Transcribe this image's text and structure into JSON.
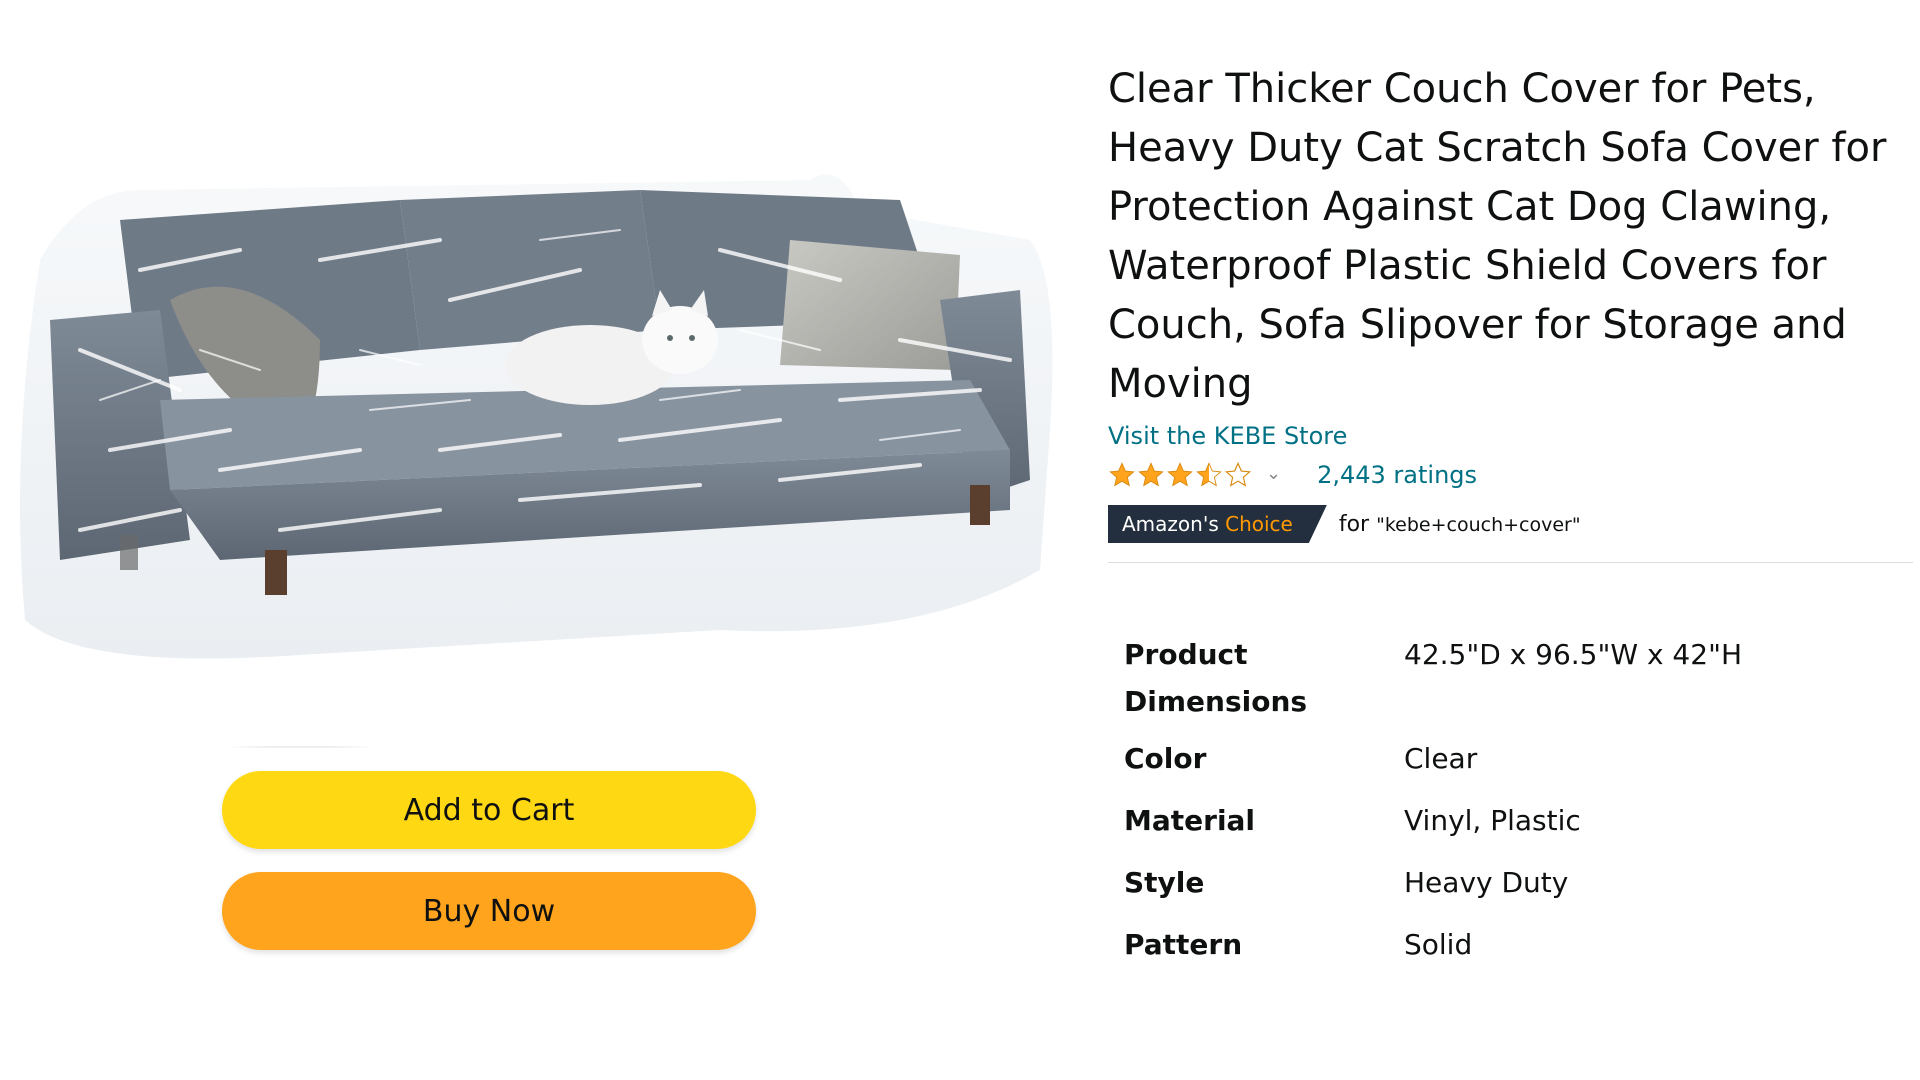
{
  "product": {
    "title": "Clear Thicker Couch Cover for Pets, Heavy Duty Cat Scratch Sofa Cover for Protection Against Cat Dog Clawing, Waterproof Plastic Shield Covers for Couch, Sofa Slipover for Storage and Moving",
    "image_alt": "Gray sofa wrapped in clear plastic cover with a white cat sitting on it",
    "store_link": "Visit the KEBE Store",
    "rating": {
      "stars": 3.5,
      "ratings_count": "2,443 ratings"
    },
    "choice_badge": {
      "label_prefix": "Amazon's",
      "label_accent": "Choice",
      "for_text": "for",
      "search_term": "\"kebe+couch+cover\""
    }
  },
  "actions": {
    "add_to_cart": "Add to Cart",
    "buy_now": "Buy Now"
  },
  "specs": [
    {
      "key": "Product Dimensions",
      "value": "42.5\"D x 96.5\"W x 42\"H"
    },
    {
      "key": "Color",
      "value": "Clear"
    },
    {
      "key": "Material",
      "value": "Vinyl, Plastic"
    },
    {
      "key": "Style",
      "value": "Heavy Duty"
    },
    {
      "key": "Pattern",
      "value": "Solid"
    }
  ],
  "colors": {
    "add_to_cart_bg": "#FFD814",
    "buy_now_bg": "#FFA41C",
    "link": "#007185",
    "star": "#FFA41C",
    "badge_bg": "#232F3E",
    "badge_accent": "#FF9900"
  }
}
